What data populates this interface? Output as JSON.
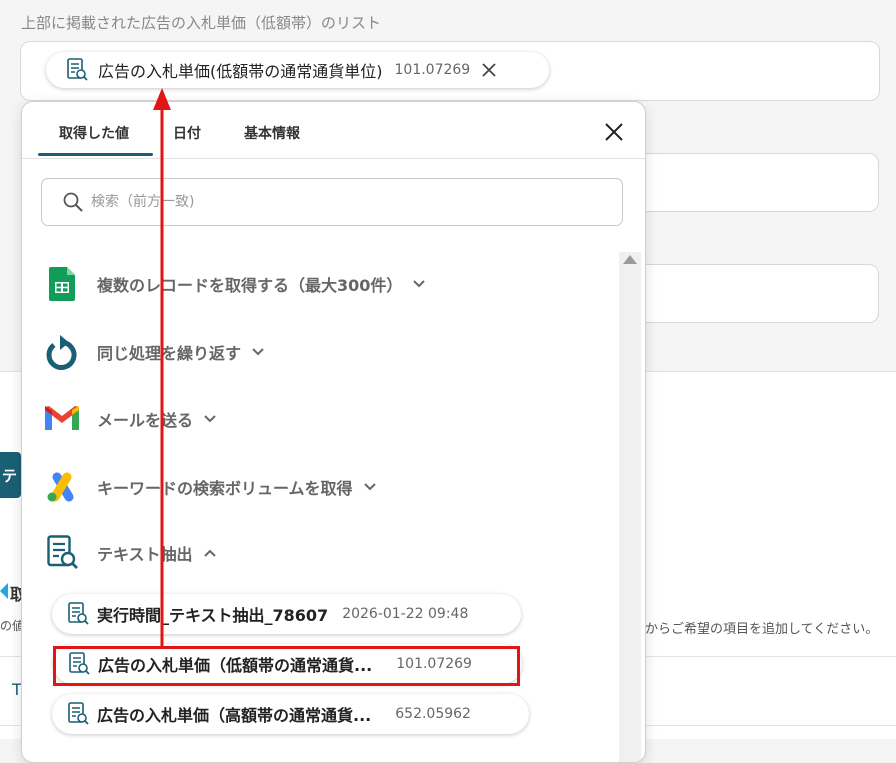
{
  "field": {
    "label": "上部に掲載された広告の入札単価（低額帯）のリスト",
    "chip": {
      "label": "広告の入札単価(低額帯の通常通貨単位)",
      "value": "101.07269"
    }
  },
  "background": {
    "left_fragment_1": "テ",
    "left_fragment_2": "取",
    "left_fragment_3": "の値",
    "left_fragment_4": "T",
    "helper_text": "からご希望の項目を追加してください。"
  },
  "dropdown": {
    "tabs": [
      "取得した値",
      "日付",
      "基本情報"
    ],
    "active_tab": 0,
    "search": {
      "placeholder": "検索（前方一致)"
    },
    "groups": [
      {
        "label": "複数のレコードを取得する（最大300件）",
        "icon": "google-sheets-icon",
        "expanded": false
      },
      {
        "label": "同じ処理を繰り返す",
        "icon": "loop-icon",
        "expanded": false
      },
      {
        "label": "メールを送る",
        "icon": "gmail-icon",
        "expanded": false
      },
      {
        "label": "キーワードの検索ボリュームを取得",
        "icon": "google-ads-icon",
        "expanded": false
      },
      {
        "label": "テキスト抽出",
        "icon": "text-extract-icon",
        "expanded": true
      }
    ],
    "items": [
      {
        "label": "実行時間_テキスト抽出_78607",
        "value": "2026-01-22 09:48"
      },
      {
        "label": "広告の入札単価（低額帯の通常通貨...",
        "value": "101.07269",
        "highlighted": true
      },
      {
        "label": "広告の入札単価（高額帯の通常通貨...",
        "value": "652.05962"
      }
    ]
  },
  "colors": {
    "accent": "#1b5f74",
    "highlight": "#e01515"
  }
}
